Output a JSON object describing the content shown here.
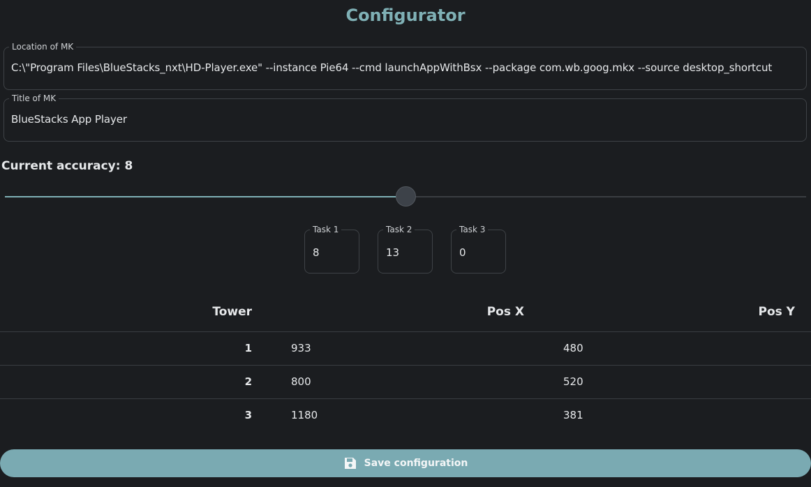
{
  "header": {
    "title": "Configurator"
  },
  "location_field": {
    "label": "Location of MK",
    "value": "C:\\\"Program Files\\BlueStacks_nxt\\HD-Player.exe\" --instance Pie64 --cmd launchAppWithBsx --package com.wb.goog.mkx --source desktop_shortcut"
  },
  "title_field": {
    "label": "Title of MK",
    "value": "BlueStacks App Player"
  },
  "accuracy": {
    "label": "Current accuracy: 8",
    "value": 8,
    "fraction": 0.5
  },
  "tasks": [
    {
      "label": "Task 1",
      "value": "8"
    },
    {
      "label": "Task 2",
      "value": "13"
    },
    {
      "label": "Task 3",
      "value": "0"
    }
  ],
  "table": {
    "headers": [
      "Tower",
      "Pos X",
      "Pos Y"
    ],
    "rows": [
      {
        "tower": "1",
        "x": "933",
        "y": "480"
      },
      {
        "tower": "2",
        "x": "800",
        "y": "520"
      },
      {
        "tower": "3",
        "x": "1180",
        "y": "381"
      }
    ]
  },
  "save_button": {
    "label": "Save configuration",
    "icon": "floppy-disk-icon"
  },
  "colors": {
    "accent": "#7fb0b5",
    "button": "#7aaab2",
    "background": "#1b1d20"
  }
}
